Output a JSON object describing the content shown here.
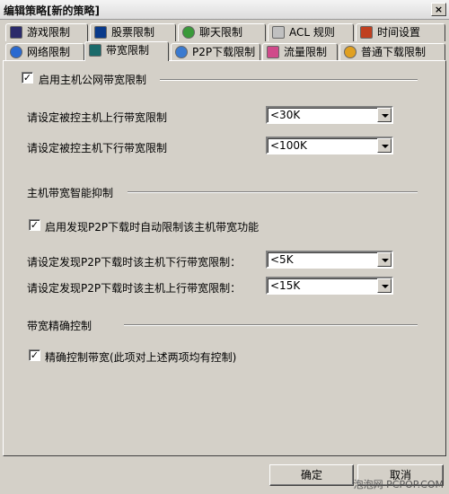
{
  "window": {
    "title": "编辑策略[新的策略]",
    "close_label": "×"
  },
  "tabs_back": [
    {
      "label": "游戏限制",
      "icon": "game-icon"
    },
    {
      "label": "股票限制",
      "icon": "stock-icon"
    },
    {
      "label": "聊天限制",
      "icon": "chat-icon"
    },
    {
      "label": "ACL 规则",
      "icon": "acl-icon"
    },
    {
      "label": "时间设置",
      "icon": "clock-icon"
    }
  ],
  "tabs_front": [
    {
      "label": "网络限制",
      "icon": "ie-icon"
    },
    {
      "label": "带宽限制",
      "icon": "bandwidth-icon",
      "active": true
    },
    {
      "label": "P2P下载限制",
      "icon": "p2p-icon"
    },
    {
      "label": "流量限制",
      "icon": "traffic-icon"
    },
    {
      "label": "普通下载限制",
      "icon": "download-icon"
    }
  ],
  "group1": {
    "title": "启用主机公网带宽限制",
    "checked": true,
    "upload_label": "请设定被控主机上行带宽限制",
    "upload_value": "<30K",
    "download_label": "请设定被控主机下行带宽限制",
    "download_value": "<100K"
  },
  "group2": {
    "title": "主机带宽智能抑制",
    "auto_label": "启用发现P2P下载时自动限制该主机带宽功能",
    "auto_checked": true,
    "down_label": "请设定发现P2P下载时该主机下行带宽限制：",
    "down_value": "<5K",
    "up_label": "请设定发现P2P下载时该主机上行带宽限制：",
    "up_value": "<15K"
  },
  "group3": {
    "title": "带宽精确控制",
    "precise_label": "精确控制带宽(此项对上述两项均有控制)",
    "precise_checked": true
  },
  "buttons": {
    "ok": "确定",
    "cancel": "取消"
  },
  "check_mark": "✓",
  "watermark": "泡泡网 PCPOP.COM"
}
